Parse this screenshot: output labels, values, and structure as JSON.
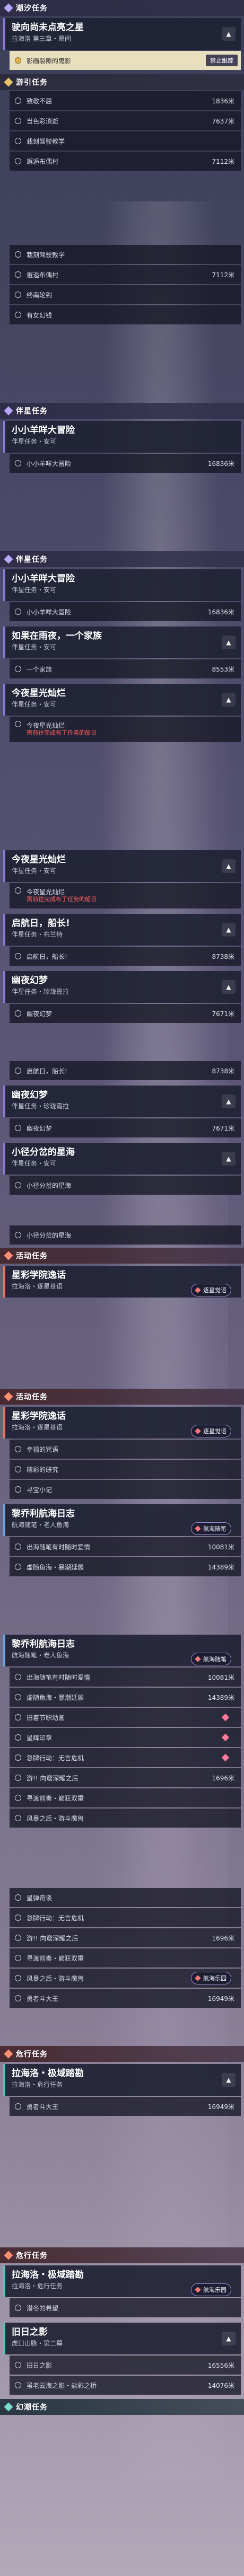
{
  "sections": {
    "tide": "潮汐任务",
    "travel": "游引任务",
    "companion": "伴星任务",
    "activity": "活动任务",
    "danger": "危行任务",
    "phantom": "幻潮任务"
  },
  "quests": {
    "q1_title": "驶向尚未点亮之星",
    "q1_sub": "拉海洛 第三章・幕间",
    "q1_step": "影画裂隙的鬼影",
    "q1_track": "禁止跟踪",
    "steps_a": [
      {
        "label": "致敬不屈",
        "dist": "1836米"
      },
      {
        "label": "当色彩消逝",
        "dist": "7637米"
      },
      {
        "label": "栽刻驾驶教学",
        "dist": ""
      },
      {
        "label": "邂逅布偶村",
        "dist": "7112米"
      }
    ],
    "steps_b": [
      {
        "label": "栽刻驾驶教学",
        "dist": ""
      },
      {
        "label": "邂逅布偶村",
        "dist": "7112米"
      },
      {
        "label": "终南轮到",
        "dist": ""
      },
      {
        "label": "有女幻钱",
        "dist": ""
      }
    ],
    "q2_title": "小小羊咩大冒险",
    "q2_sub": "伴星任务・安可",
    "q2_step": "小小羊咩大冒险",
    "q2_dist": "16836米",
    "q3_title": "如果在雨夜，一个家族",
    "q3_sub": "伴星任务・安可",
    "q3_step": "一个家族",
    "q3_dist": "8553米",
    "q4_title": "今夜星光灿烂",
    "q4_sub": "伴星任务・安可",
    "q4_step": "今夜星光灿烂",
    "q4_warn": "需前往完成布丁任务的船日",
    "q5_title": "今夜星光灿烂",
    "q5_sub": "伴星任务・安可",
    "q5_step": "今夜星光灿烂",
    "q5_warn": "需前往完成布丁任务的船日",
    "q6_title": "启航日，船长!",
    "q6_sub": "伴星任务・布兰特",
    "q6_step": "启航日，船长!",
    "q6_dist": "8738米",
    "q7_title": "幽夜幻梦",
    "q7_sub": "伴星任务・珍珑霞拉",
    "q7_step": "幽夜幻梦",
    "q7_dist": "7671米",
    "q7b_step": "启航日，船长!",
    "q7b_dist": "8738米",
    "q8_title": "幽夜幻梦",
    "q8_sub": "伴星任务・珍珑霞拉",
    "q8_step": "幽夜幻梦",
    "q8_dist": "7671米",
    "q9_title": "小径分岔的星海",
    "q9_sub": "伴星任务・安可",
    "q9_step": "小径分岔的星海",
    "q10_step": "小径分岔的星海",
    "q11_title": "星彩学院逸话",
    "q11_sub": "拉海洛・逐星苍语",
    "q11_badge": "逐星觉语",
    "q12_title": "星彩学院逸话",
    "q12_sub": "拉海洛・逐星苍语",
    "q12_badge": "逐星觉语",
    "q12_steps": [
      "幸福的咒语",
      "精彩的研究",
      "寻宝小记"
    ],
    "q13_title": "黎乔利航海日志",
    "q13_sub": "航海随笔・老人鱼海",
    "q13_badge": "航海随笔",
    "q13_steps": [
      {
        "label": "出海随笔有时随时爱情",
        "dist": "10081米"
      },
      {
        "label": "虚随鱼海・暴潮延展",
        "dist": "14389米"
      }
    ],
    "q14_title": "黎乔利航海日志",
    "q14_sub": "航海随笔・老人鱼海",
    "q14_badge": "航海随笔",
    "q14_steps": [
      {
        "label": "出海随笔有时随时爱情",
        "dist": "10081米"
      },
      {
        "label": "虚随鱼海・暴潮延展",
        "dist": "14389米"
      },
      {
        "label": "旧着节职动画",
        "dist": ""
      },
      {
        "label": "星辉印章",
        "dist": ""
      },
      {
        "label": "忽牌行动：无言危机",
        "dist": ""
      },
      {
        "label": "游!! 向窟深耀之后",
        "dist": "1696米"
      },
      {
        "label": "寻渡前奏・巅狂双重",
        "dist": ""
      },
      {
        "label": "风暴之后・游斗魔兽",
        "dist": ""
      }
    ],
    "q15_steps": [
      {
        "label": "星弹奇谈",
        "dist": ""
      },
      {
        "label": "忽牌行动：无言危机",
        "dist": ""
      },
      {
        "label": "游!! 向窟深耀之后",
        "dist": "1696米"
      },
      {
        "label": "寻渡前奏・巅狂双重",
        "dist": ""
      },
      {
        "label": "风暴之后・游斗魔兽",
        "dist": ""
      },
      {
        "label": "勇者斗大王",
        "dist": "16949米"
      }
    ],
    "q15_badge": "航海乐园",
    "q16_title": "拉海洛・极域踏勘",
    "q16_sub": "拉海洛・危行任务",
    "q16_steps": [
      {
        "label": "勇者斗大王",
        "dist": "16949米"
      }
    ],
    "q17_title": "拉海洛・极域踏勘",
    "q17_sub": "拉海洛・危行任务",
    "q17_badge": "航海乐园",
    "q17_steps": [
      {
        "label": "潜冬的希望",
        "dist": ""
      }
    ],
    "q18_title": "旧日之影",
    "q18_sub": "虎口山脉・第二幕",
    "q18_steps": [
      {
        "label": "旧日之影",
        "dist": "16556米"
      },
      {
        "label": "虽老云海之影・盐彩之桥",
        "dist": "14076米"
      }
    ]
  }
}
